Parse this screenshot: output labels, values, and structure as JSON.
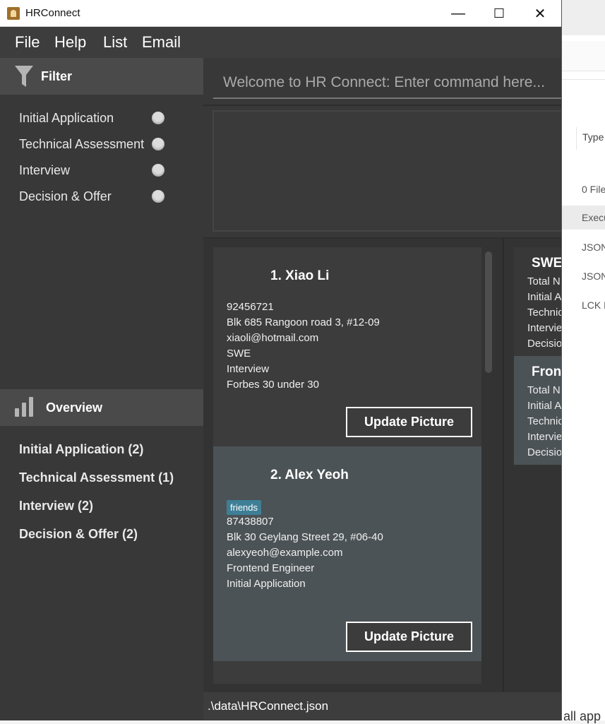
{
  "window": {
    "title": "HRConnect",
    "minimize": "—",
    "maximize": "☐",
    "close": "✕"
  },
  "menu": [
    "File",
    "Help",
    "List",
    "Email"
  ],
  "filter": {
    "header": "Filter",
    "items": [
      "Initial Application",
      "Technical Assessment",
      "Interview",
      "Decision & Offer"
    ]
  },
  "overview": {
    "header": "Overview",
    "items": [
      "Initial Application (2)",
      "Technical Assessment (1)",
      "Interview (2)",
      "Decision & Offer (2)"
    ]
  },
  "command": {
    "placeholder": "Welcome to HR Connect: Enter command here..."
  },
  "persons": [
    {
      "name": "1.  Xiao Li",
      "lines": [
        "92456721",
        "Blk 685 Rangoon road 3, #12-09",
        "xiaoli@hotmail.com",
        "SWE",
        "Interview",
        "Forbes 30 under 30"
      ],
      "button": "Update Picture"
    },
    {
      "name": "2.  Alex Yeoh",
      "tag": "friends",
      "lines": [
        "87438807",
        "Blk 30 Geylang Street 29, #06-40",
        "alexyeoh@example.com",
        "Frontend Engineer",
        "Initial Application"
      ],
      "button": "Update Picture"
    }
  ],
  "roleOverview": [
    {
      "title": "SWE",
      "stats": [
        "Total N",
        "Initial A",
        "Technic",
        "Intervie",
        "Decisio"
      ]
    },
    {
      "title": "Front",
      "stats": [
        "Total N",
        "Initial A",
        "Technic",
        "Intervie",
        "Decisio"
      ]
    }
  ],
  "status": {
    "path": ".\\data\\HRConnect.json"
  },
  "background": {
    "column": "Type",
    "rows": [
      "0 File",
      "Execu",
      "JSON",
      "JSON",
      "LCK F"
    ],
    "bottom": "all app"
  },
  "colors": {
    "accent_tag": "#3e7f96",
    "dark_bg": "#383838"
  }
}
